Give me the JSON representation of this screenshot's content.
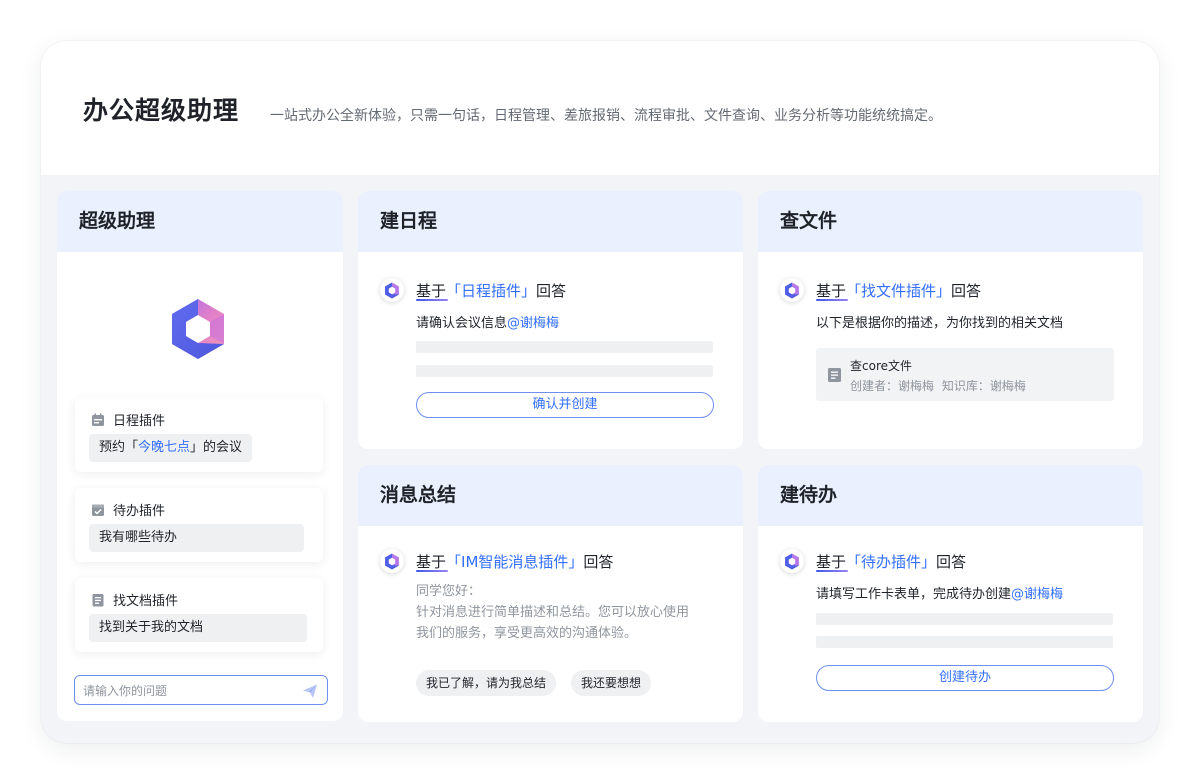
{
  "header": {
    "title": "办公超级助理",
    "subtitle": "一站式办公全新体验，只需一句话，日程管理、差旅报销、流程审批、文件查询、业务分析等功能统统搞定。"
  },
  "assistant": {
    "title": "超级助理",
    "plugins": [
      {
        "name": "日程插件",
        "icon": "calendar-icon",
        "query_prefix": "预约「",
        "query_highlight": "今晚七点",
        "query_suffix": "」的会议"
      },
      {
        "name": "待办插件",
        "icon": "todo-check-icon",
        "query": "我有哪些待办"
      },
      {
        "name": "找文档插件",
        "icon": "document-icon",
        "query": "找到关于我的文档"
      }
    ],
    "input_placeholder": "请输入你的问题"
  },
  "cards": {
    "schedule": {
      "title": "建日程",
      "reply_base": "基于",
      "reply_plugin": "「日程插件」",
      "reply_suffix": "回答",
      "message": "请确认会议信息",
      "mention": "@谢梅梅",
      "button": "确认并创建"
    },
    "files": {
      "title": "查文件",
      "reply_base": "基于",
      "reply_plugin": "「找文件插件」",
      "reply_suffix": "回答",
      "message": "以下是根据你的描述，为你找到的相关文档",
      "doc_name": "查core文件",
      "doc_meta": "创建者：谢梅梅 知识库：谢梅梅"
    },
    "summary": {
      "title": "消息总结",
      "reply_base": "基于",
      "reply_plugin": "「IM智能消息插件」",
      "reply_suffix": "回答",
      "greeting": "同学您好：",
      "body_line1": "针对消息进行简单描述和总结。您可以放心使用",
      "body_line2": "我们的服务，享受更高效的沟通体验。",
      "chips": [
        "我已了解，请为我总结",
        "我还要想想"
      ]
    },
    "todo": {
      "title": "建待办",
      "reply_base": "基于",
      "reply_plugin": "「待办插件」",
      "reply_suffix": "回答",
      "message": "请填写工作卡表单，完成待办创建",
      "mention": "@谢梅梅",
      "button": "创建待办"
    }
  },
  "colors": {
    "accent": "#3370ff",
    "card_header_bg": "#eaf0fd",
    "page_bg": "#f2f4f7"
  }
}
